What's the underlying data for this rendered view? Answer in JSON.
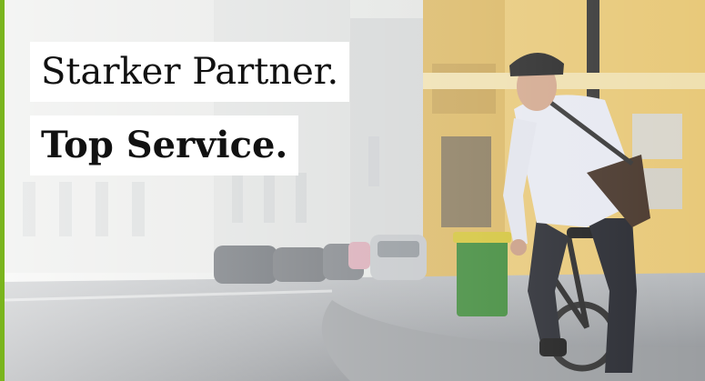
{
  "headline": {
    "line1": "Starker Partner.",
    "line2": "Top Service."
  },
  "colors": {
    "accent": "#7ab51d",
    "headline_bg": "#ffffff",
    "headline_text": "#111111",
    "facade_yellow": "#e8c97a",
    "bin_green": "#3f8a3a"
  },
  "icons": {
    "cyclist": "cyclist-photo",
    "street": "street-photo"
  }
}
